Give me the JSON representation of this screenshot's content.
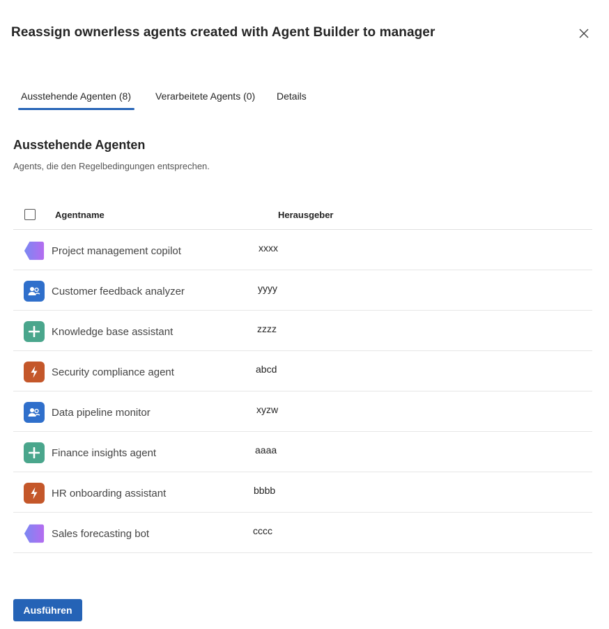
{
  "dialog": {
    "title": "Reassign ownerless agents created with Agent Builder to manager",
    "close_icon": "close-icon"
  },
  "tabs": [
    {
      "label": "Ausstehende Agenten (8)",
      "active": true
    },
    {
      "label": "Verarbeitete Agents (0)",
      "active": false
    },
    {
      "label": "Details",
      "active": false
    }
  ],
  "section": {
    "title": "Ausstehende Agenten",
    "subtitle": "Agents, die den Regelbedingungen entsprechen."
  },
  "table": {
    "columns": [
      "Agentname",
      "Herausgeber"
    ],
    "rows": [
      {
        "name": "Project management copilot",
        "publisher": "xxxx",
        "icon": "purple-hexagon-icon"
      },
      {
        "name": "Customer feedback analyzer",
        "publisher": "yyyy",
        "icon": "blue-people-icon"
      },
      {
        "name": "Knowledge base assistant",
        "publisher": "zzzz",
        "icon": "green-plus-icon"
      },
      {
        "name": "Security compliance agent",
        "publisher": "abcd",
        "icon": "orange-lightning-icon"
      },
      {
        "name": "Data pipeline monitor",
        "publisher": "xyzw",
        "icon": "blue-people-icon"
      },
      {
        "name": "Finance insights agent",
        "publisher": "aaaa",
        "icon": "green-plus-icon"
      },
      {
        "name": "HR onboarding assistant",
        "publisher": "bbbb",
        "icon": "orange-lightning-icon"
      },
      {
        "name": "Sales forecasting bot",
        "publisher": "cccc",
        "icon": "purple-hexagon-icon"
      }
    ]
  },
  "actions": {
    "run_label": "Ausführen"
  },
  "colors": {
    "accent": "#2563b6",
    "blue_icon": "#2f6fcb",
    "green_icon": "#4aa68c",
    "orange_icon": "#c4572a",
    "purple_start": "#7a88f2",
    "purple_end": "#b46cf0"
  }
}
